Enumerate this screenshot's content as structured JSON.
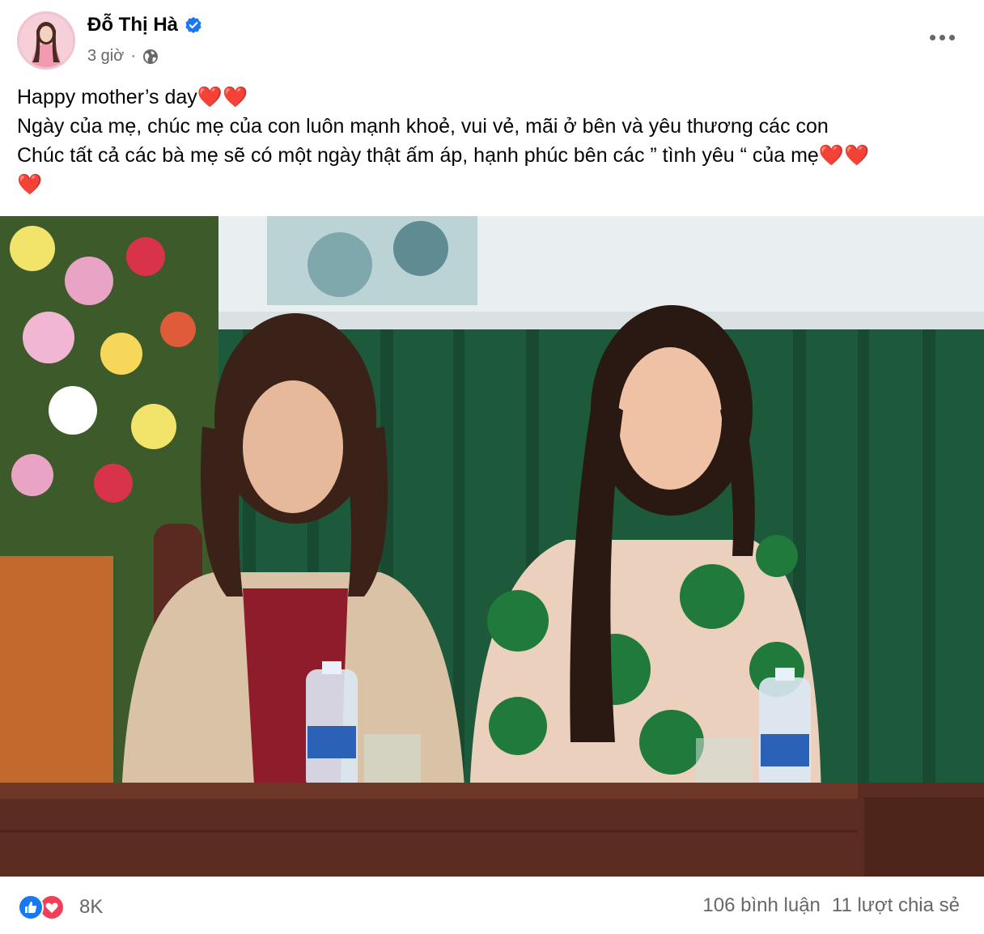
{
  "post": {
    "author_name": "Đỗ Thị Hà",
    "timestamp": "3 giờ",
    "separator": "·",
    "audience_icon": "globe-icon",
    "verified_icon": "verified-badge-icon",
    "more_icon": "more-options-icon",
    "caption": {
      "line1_text": "Happy mother’s day",
      "line1_emoji": "❤️❤️",
      "line2_text": "Ngày của mẹ, chúc mẹ của con luôn mạnh khoẻ, vui vẻ, mãi ở bên và yêu thương các con",
      "line3_text": "Chúc tất cả các bà mẹ sẽ có một ngày thật ấm áp, hạnh phúc bên các ” tình yêu “ của mẹ",
      "line3_emoji": "❤️❤️",
      "line4_emoji": "❤️"
    }
  },
  "footer": {
    "reaction_icons": [
      "like-icon",
      "love-icon"
    ],
    "reaction_count": "8K",
    "comments": "106 bình luận",
    "shares": "11 lượt chia sẻ"
  },
  "colors": {
    "text_primary": "#050505",
    "text_secondary": "#65676b",
    "verified_blue": "#1877f2",
    "heart_red": "#e41e3f",
    "love_red": "#f33e58"
  }
}
